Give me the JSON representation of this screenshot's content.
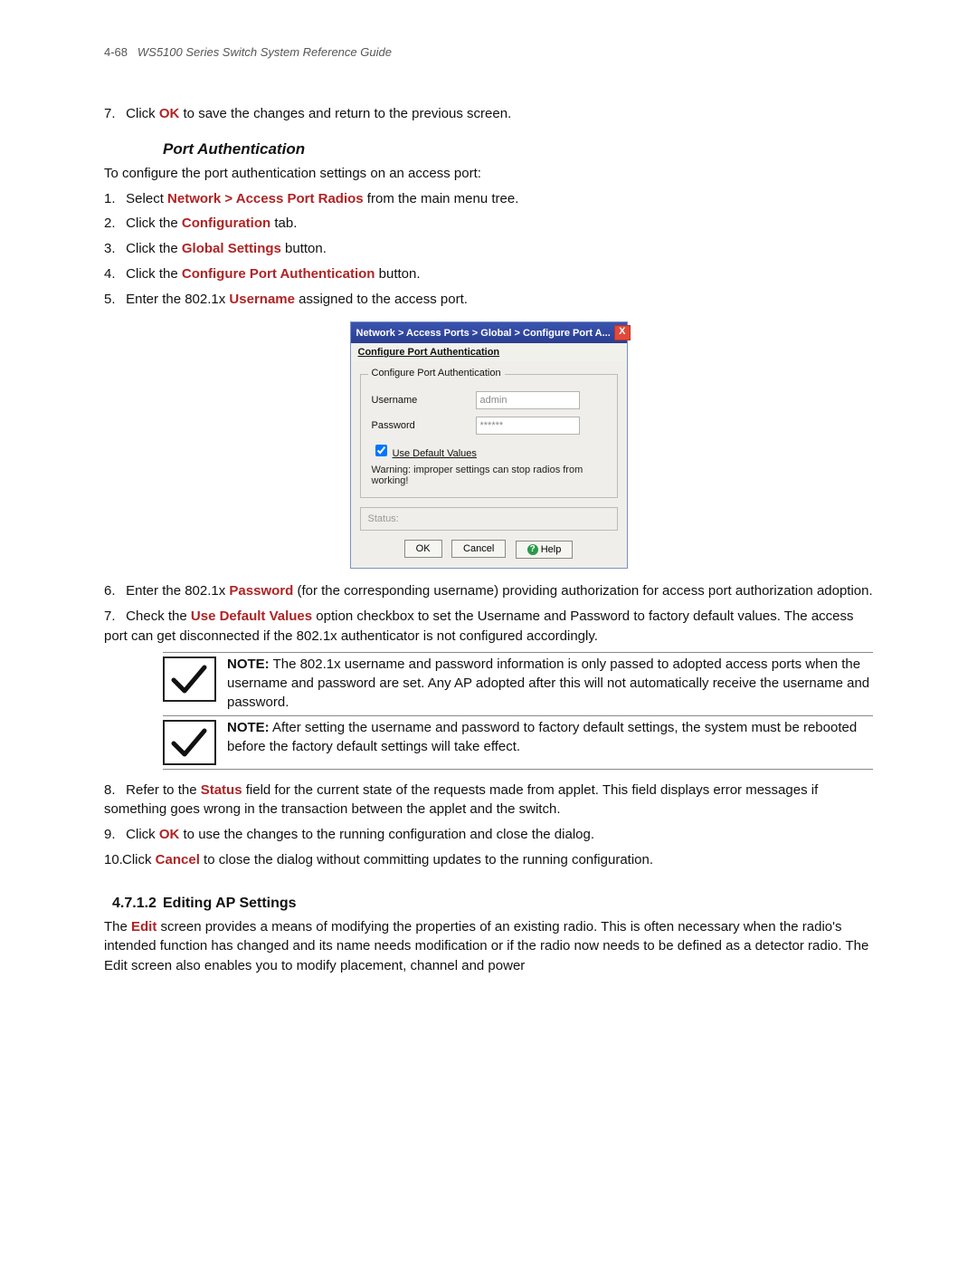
{
  "header": {
    "page_number": "4-68",
    "doc_title": "WS5100 Series Switch System Reference Guide"
  },
  "step7_top": {
    "num": "7.",
    "pre": "Click ",
    "emph": "OK",
    "post": " to save the changes and return to the previous screen."
  },
  "section": {
    "title": "Port Authentication",
    "intro": "To configure the port authentication settings on an access port:"
  },
  "steps_a": {
    "s1": {
      "num": "1.",
      "pre": "Select ",
      "emph": "Network > Access Port Radios",
      "post": " from the main menu tree."
    },
    "s2": {
      "num": "2.",
      "pre": "Click the ",
      "emph": "Configuration",
      "post": " tab."
    },
    "s3": {
      "num": "3.",
      "pre": "Click the ",
      "emph": "Global Settings",
      "post": " button."
    },
    "s4": {
      "num": "4.",
      "pre": "Click the ",
      "emph": "Configure Port Authentication",
      "post": " button."
    },
    "s5": {
      "num": "5.",
      "pre": "Enter the 802.1x ",
      "emph": "Username",
      "post": " assigned to the access port."
    }
  },
  "dialog": {
    "title": "Network > Access Ports > Global > Configure Port A...",
    "subtitle": "Configure Port Authentication",
    "group_legend": "Configure Port Authentication",
    "username_label": "Username",
    "username_value": "admin",
    "password_label": "Password",
    "password_value": "******",
    "use_default": "Use Default Values",
    "warning": "Warning: improper settings can stop radios from working!",
    "status_label": "Status:",
    "btn_ok": "OK",
    "btn_cancel": "Cancel",
    "btn_help": "Help"
  },
  "steps_b": {
    "s6": {
      "num": "6.",
      "pre": "Enter the 802.1x ",
      "emph": "Password",
      "post": " (for the corresponding username) providing authorization for access port authorization adoption."
    },
    "s7": {
      "num": "7.",
      "pre": "Check the ",
      "emph": "Use Default Values",
      "post": " option checkbox to set the Username and Password to factory default values. The access port can get disconnected if the 802.1x authenticator is not configured accordingly."
    }
  },
  "notes": {
    "n1": {
      "label": "NOTE:",
      "text": " The 802.1x username and password information is only passed to adopted access ports when the username and password are set. Any AP adopted after this will not automatically receive the username and password."
    },
    "n2": {
      "label": "NOTE:",
      "text": " After setting the username and password to factory default settings, the system must be rebooted before the factory default settings will take effect."
    }
  },
  "steps_c": {
    "s8": {
      "num": "8.",
      "pre": "Refer to the ",
      "emph": "Status",
      "post": " field for the current state of the requests made from applet. This field displays error messages if something goes wrong in the transaction between the applet and the switch."
    },
    "s9": {
      "num": "9.",
      "pre": "Click ",
      "emph": "OK",
      "post": " to use the changes to the running configuration and close the dialog."
    },
    "s10": {
      "num": "10.",
      "pre": "Click ",
      "emph": "Cancel",
      "post": " to close the dialog without committing updates to the running configuration."
    }
  },
  "subsection": {
    "num": "4.7.1.2",
    "title": "Editing AP Settings",
    "body_pre": "The ",
    "body_emph": "Edit",
    "body_post": " screen provides a means of modifying the properties of an existing radio. This is often necessary when the radio's intended function has changed and its name needs modification or if the radio now needs to be defined as a detector radio. The Edit screen also enables you to modify placement, channel and power"
  }
}
